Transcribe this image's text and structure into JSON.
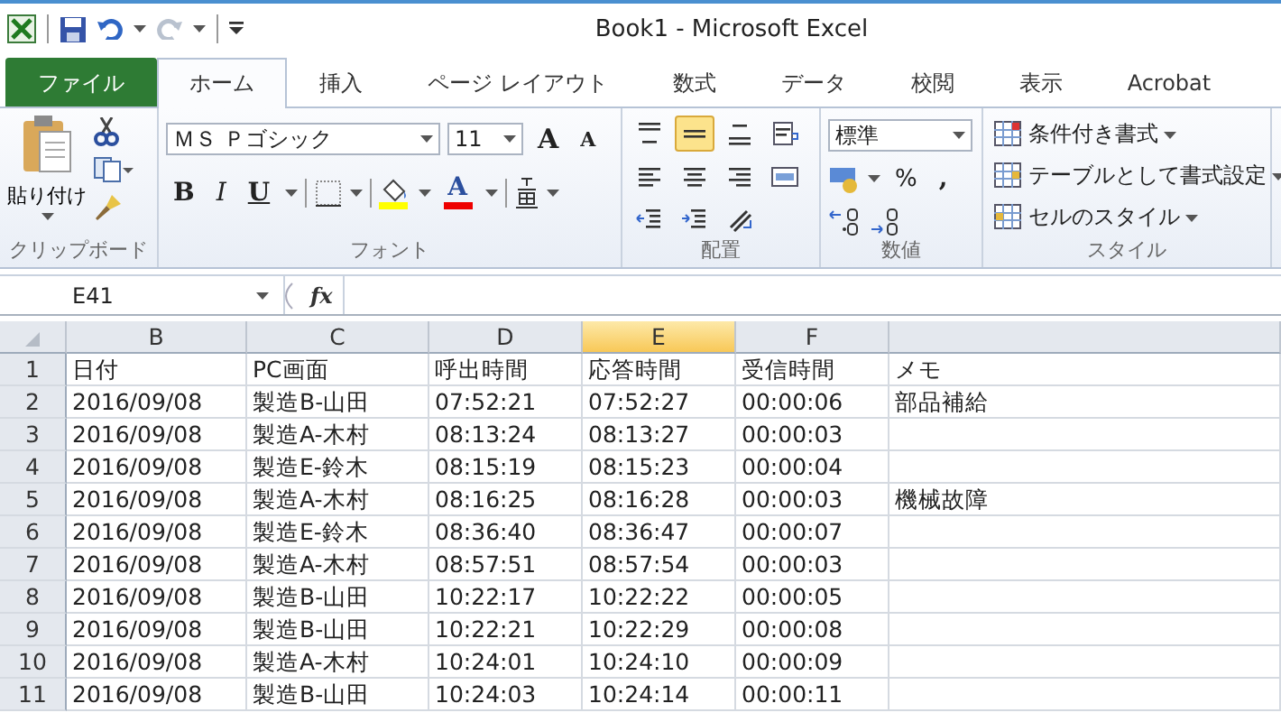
{
  "window": {
    "title": "Book1 - Microsoft Excel"
  },
  "tabs": [
    {
      "label": "ファイル",
      "kind": "file",
      "selected": false
    },
    {
      "label": "ホーム",
      "kind": "tab",
      "selected": true
    },
    {
      "label": "挿入",
      "kind": "tab",
      "selected": false
    },
    {
      "label": "ページ レイアウト",
      "kind": "tab",
      "selected": false
    },
    {
      "label": "数式",
      "kind": "tab",
      "selected": false
    },
    {
      "label": "データ",
      "kind": "tab",
      "selected": false
    },
    {
      "label": "校閲",
      "kind": "tab",
      "selected": false
    },
    {
      "label": "表示",
      "kind": "tab",
      "selected": false
    },
    {
      "label": "Acrobat",
      "kind": "tab",
      "selected": false
    }
  ],
  "clipboard": {
    "label": "クリップボード",
    "paste": "貼り付け"
  },
  "font": {
    "label": "フォント",
    "font_name": "ＭＳ Ｐゴシック",
    "font_size": "11",
    "grow": "A",
    "shrink": "A",
    "bold": "B",
    "italic": "I",
    "underline": "U",
    "font_color": "A"
  },
  "alignment": {
    "label": "配置",
    "buttons": [
      {
        "kind": "top",
        "selected": false
      },
      {
        "kind": "middle",
        "selected": true
      },
      {
        "kind": "bottom",
        "selected": false
      },
      {
        "kind": "wrap",
        "selected": false
      },
      {
        "kind": "left",
        "selected": false
      },
      {
        "kind": "center",
        "selected": false
      },
      {
        "kind": "right",
        "selected": false
      },
      {
        "kind": "merge",
        "selected": false
      },
      {
        "kind": "outdent",
        "selected": false
      },
      {
        "kind": "indent",
        "selected": false
      },
      {
        "kind": "orient",
        "selected": false
      }
    ]
  },
  "number": {
    "label": "数値",
    "format": "標準",
    "percent": "%",
    "comma": ","
  },
  "styles": {
    "label": "スタイル",
    "buttons": [
      "条件付き書式",
      "テーブルとして書式設定",
      "セルのスタイル"
    ]
  },
  "formula_bar": {
    "name_box": "E41",
    "fx": "fx"
  },
  "sheet": {
    "columns": [
      {
        "label": "B",
        "selected": false
      },
      {
        "label": "C",
        "selected": false
      },
      {
        "label": "D",
        "selected": false
      },
      {
        "label": "E",
        "selected": true
      },
      {
        "label": "F",
        "selected": false
      },
      {
        "selected": false
      }
    ],
    "rows": [
      {
        "header": "1",
        "cells": [
          "日付",
          "PC画面",
          "呼出時間",
          "応答時間",
          "受信時間",
          "メモ"
        ]
      },
      {
        "header": "2",
        "cells": [
          "2016/09/08",
          "製造B-山田",
          "07:52:21",
          "07:52:27",
          "00:00:06",
          "部品補給"
        ]
      },
      {
        "header": "3",
        "cells": [
          "2016/09/08",
          "製造A-木村",
          "08:13:24",
          "08:13:27",
          "00:00:03",
          ""
        ]
      },
      {
        "header": "4",
        "cells": [
          "2016/09/08",
          "製造E-鈴木",
          "08:15:19",
          "08:15:23",
          "00:00:04",
          ""
        ]
      },
      {
        "header": "5",
        "cells": [
          "2016/09/08",
          "製造A-木村",
          "08:16:25",
          "08:16:28",
          "00:00:03",
          "機械故障"
        ]
      },
      {
        "header": "6",
        "cells": [
          "2016/09/08",
          "製造E-鈴木",
          "08:36:40",
          "08:36:47",
          "00:00:07",
          ""
        ]
      },
      {
        "header": "7",
        "cells": [
          "2016/09/08",
          "製造A-木村",
          "08:57:51",
          "08:57:54",
          "00:00:03",
          ""
        ]
      },
      {
        "header": "8",
        "cells": [
          "2016/09/08",
          "製造B-山田",
          "10:22:17",
          "10:22:22",
          "00:00:05",
          ""
        ]
      },
      {
        "header": "9",
        "cells": [
          "2016/09/08",
          "製造B-山田",
          "10:22:21",
          "10:22:29",
          "00:00:08",
          ""
        ]
      },
      {
        "header": "10",
        "cells": [
          "2016/09/08",
          "製造A-木村",
          "10:24:01",
          "10:24:10",
          "00:00:09",
          ""
        ]
      },
      {
        "header": "11",
        "cells": [
          "2016/09/08",
          "製造B-山田",
          "10:24:03",
          "10:24:14",
          "00:00:11",
          ""
        ]
      }
    ]
  }
}
